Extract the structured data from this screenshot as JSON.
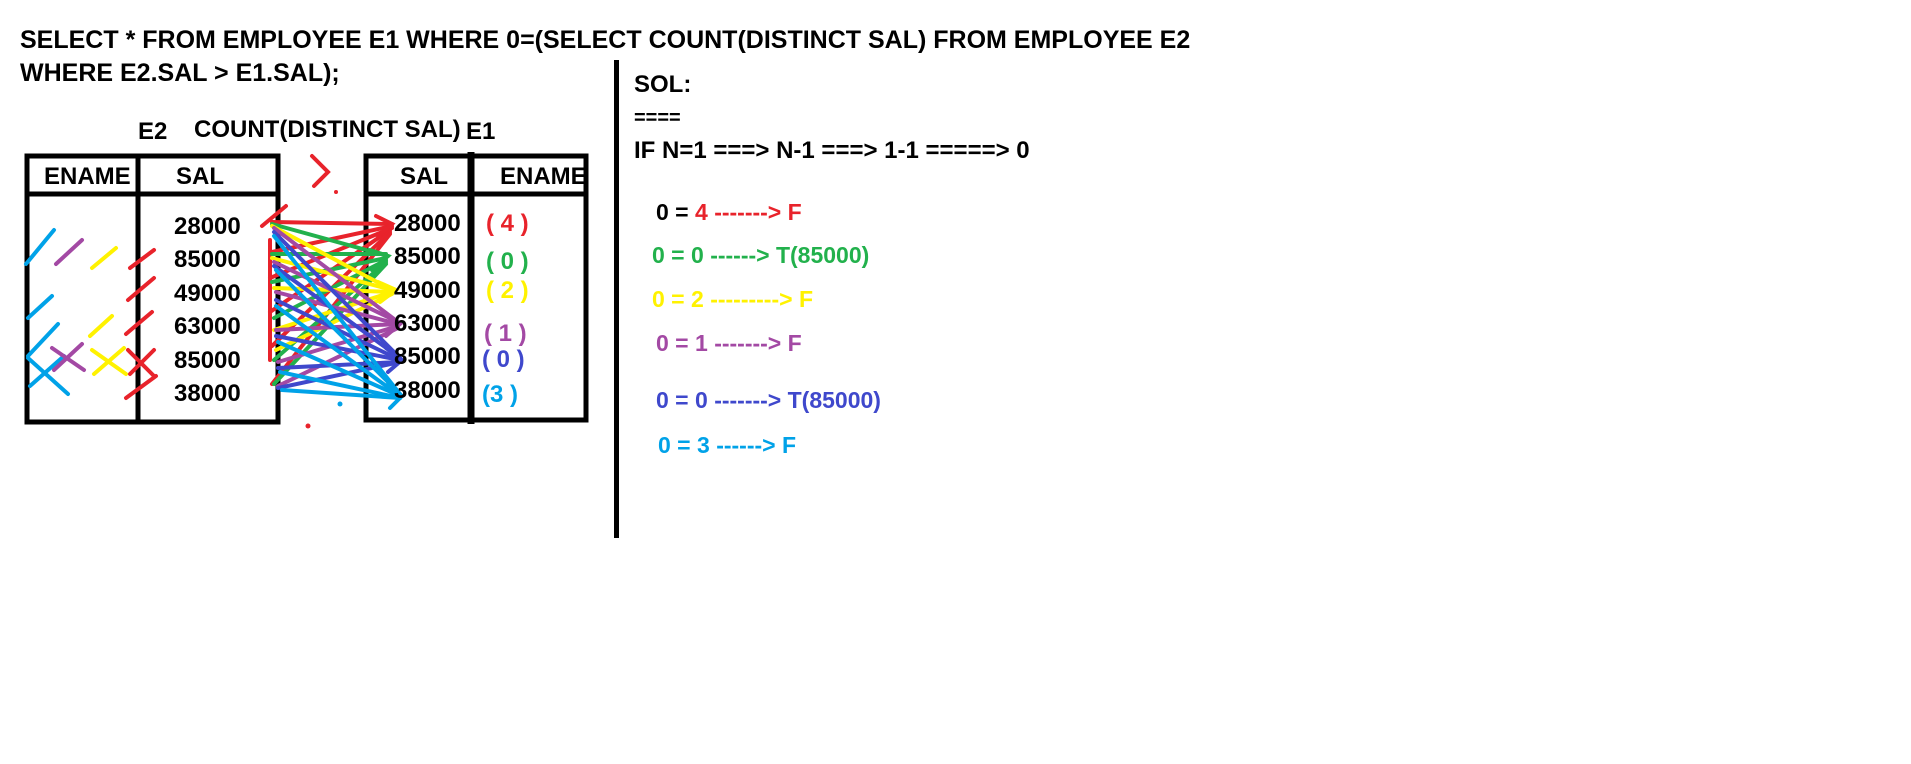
{
  "query": {
    "line1": "SELECT * FROM EMPLOYEE E1 WHERE 0=(SELECT COUNT(DISTINCT SAL) FROM EMPLOYEE E2",
    "line2": "WHERE E2.SAL > E1.SAL);"
  },
  "labels": {
    "e2": "E2",
    "count_distinct": "COUNT(DISTINCT SAL)",
    "e1": "E1",
    "greater_than": ">"
  },
  "e2_table": {
    "headers": [
      "ENAME",
      "SAL"
    ],
    "sal_values": [
      "28000",
      "85000",
      "49000",
      "63000",
      "85000",
      "38000"
    ]
  },
  "e1_table": {
    "headers": [
      "SAL",
      "ENAME"
    ],
    "sal_values": [
      "28000",
      "85000",
      "49000",
      "63000",
      "85000",
      "38000"
    ],
    "counts": [
      "( 4 )",
      "( 0 )",
      "( 2 )",
      "( 1 )",
      "( 0 )",
      "(3 )"
    ]
  },
  "solution": {
    "title": "SOL:",
    "underline": "====",
    "formula": "IF N=1 ===> N-1 ===> 1-1 =====> 0",
    "rows": [
      {
        "lhs": "0  = ",
        "rhs": "4 -------> F"
      },
      {
        "lhs": "0   = ",
        "rhs": "0 ------> T(85000)"
      },
      {
        "lhs": "0 = ",
        "rhs": "2 ---------> F"
      },
      {
        "lhs": "0 = ",
        "rhs": "1 -------> F"
      },
      {
        "lhs": "0 = ",
        "rhs": "0 -------> T(85000)"
      },
      {
        "lhs": "0 = ",
        "rhs": "3 ------> F"
      }
    ]
  },
  "colors": {
    "red": "#e8232b",
    "green": "#22b14c",
    "yellow": "#fff200",
    "purple": "#a349a4",
    "blue": "#3f48cc",
    "cyan": "#00a2e8",
    "black": "#000000"
  }
}
